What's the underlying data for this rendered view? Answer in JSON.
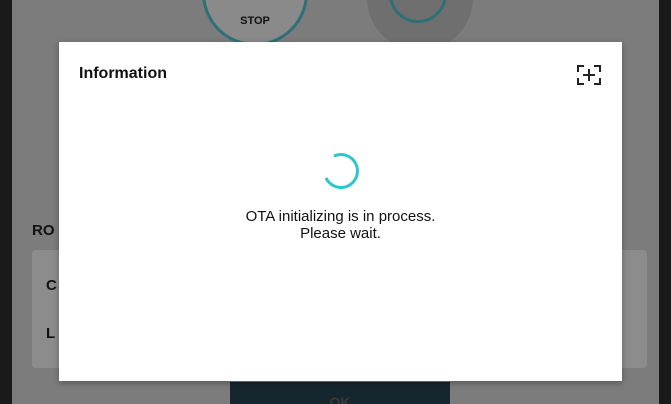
{
  "background": {
    "stop_label": "STOP",
    "section_label": "RO",
    "row1_label": "C",
    "row2_label": "L",
    "ok_label": "OK"
  },
  "dialog": {
    "title": "Information",
    "expand_icon": "expand-icon",
    "message_line1": "OTA initializing is in process.",
    "message_line2": "Please wait."
  },
  "colors": {
    "accent": "#2ec4cc",
    "ring": "#2e6f78",
    "ok_bg": "#16262e"
  }
}
